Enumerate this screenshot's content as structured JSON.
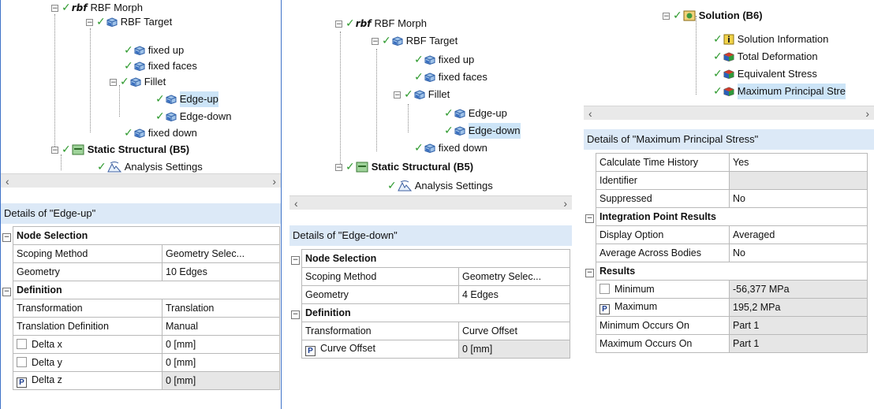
{
  "panel1": {
    "tree": {
      "rbf_morph": "RBF Morph",
      "rbf_target": "RBF Target",
      "fixed_up": "fixed up",
      "fixed_faces": "fixed faces",
      "fillet": "Fillet",
      "edge_up": "Edge-up",
      "edge_down": "Edge-down",
      "fixed_down": "fixed down",
      "static_structural": "Static Structural (B5)",
      "analysis_settings": "Analysis Settings"
    },
    "details_title": "Details of \"Edge-up\"",
    "rows": {
      "node_selection": "Node Selection",
      "scoping_method": "Scoping Method",
      "scoping_method_val": "Geometry Selec...",
      "geometry": "Geometry",
      "geometry_val": "10 Edges",
      "definition": "Definition",
      "transformation": "Transformation",
      "transformation_val": "Translation",
      "translation_def": "Translation Definition",
      "translation_def_val": "Manual",
      "delta_x": "Delta x",
      "delta_x_val": "0 [mm]",
      "delta_y": "Delta y",
      "delta_y_val": "0 [mm]",
      "delta_z": "Delta z",
      "delta_z_val": "0 [mm]",
      "p_flag": "P"
    }
  },
  "panel2": {
    "tree": {
      "rbf_morph": "RBF Morph",
      "rbf_target": "RBF Target",
      "fixed_up": "fixed up",
      "fixed_faces": "fixed faces",
      "fillet": "Fillet",
      "edge_up": "Edge-up",
      "edge_down": "Edge-down",
      "fixed_down": "fixed down",
      "static_structural": "Static Structural (B5)",
      "analysis_settings": "Analysis Settings"
    },
    "details_title": "Details of \"Edge-down\"",
    "rows": {
      "node_selection": "Node Selection",
      "scoping_method": "Scoping Method",
      "scoping_method_val": "Geometry Selec...",
      "geometry": "Geometry",
      "geometry_val": "4 Edges",
      "definition": "Definition",
      "transformation": "Transformation",
      "transformation_val": "Curve Offset",
      "curve_offset": "Curve Offset",
      "curve_offset_val": "0 [mm]",
      "p_flag": "P"
    }
  },
  "panel3": {
    "tree": {
      "solution": "Solution (B6)",
      "solution_info": "Solution Information",
      "total_deformation": "Total Deformation",
      "equivalent_stress": "Equivalent Stress",
      "max_principal": "Maximum Principal Stre"
    },
    "details_title": "Details of \"Maximum Principal Stress\"",
    "rows": {
      "calc_time_history": "Calculate Time History",
      "calc_time_history_val": "Yes",
      "identifier": "Identifier",
      "identifier_val": "",
      "suppressed": "Suppressed",
      "suppressed_val": "No",
      "integration": "Integration Point Results",
      "display_option": "Display Option",
      "display_option_val": "Averaged",
      "avg_across": "Average Across Bodies",
      "avg_across_val": "No",
      "results": "Results",
      "minimum": "Minimum",
      "minimum_val": "-56,377 MPa",
      "maximum": "Maximum",
      "maximum_val": "195,2 MPa",
      "min_occurs": "Minimum Occurs On",
      "min_occurs_val": "Part 1",
      "max_occurs": "Maximum Occurs On",
      "max_occurs_val": "Part 1",
      "p_flag": "P"
    }
  },
  "glyphs": {
    "expand_minus": "−",
    "check": "✓",
    "scroll_left": "‹",
    "scroll_right": "›",
    "rbf_logo": "rbf"
  },
  "colors": {
    "header_bg": "#dce9f7",
    "border_blue": "#3f73c8",
    "check_green": "#2e9a2e",
    "cube_blue": "#2d5fa8"
  }
}
